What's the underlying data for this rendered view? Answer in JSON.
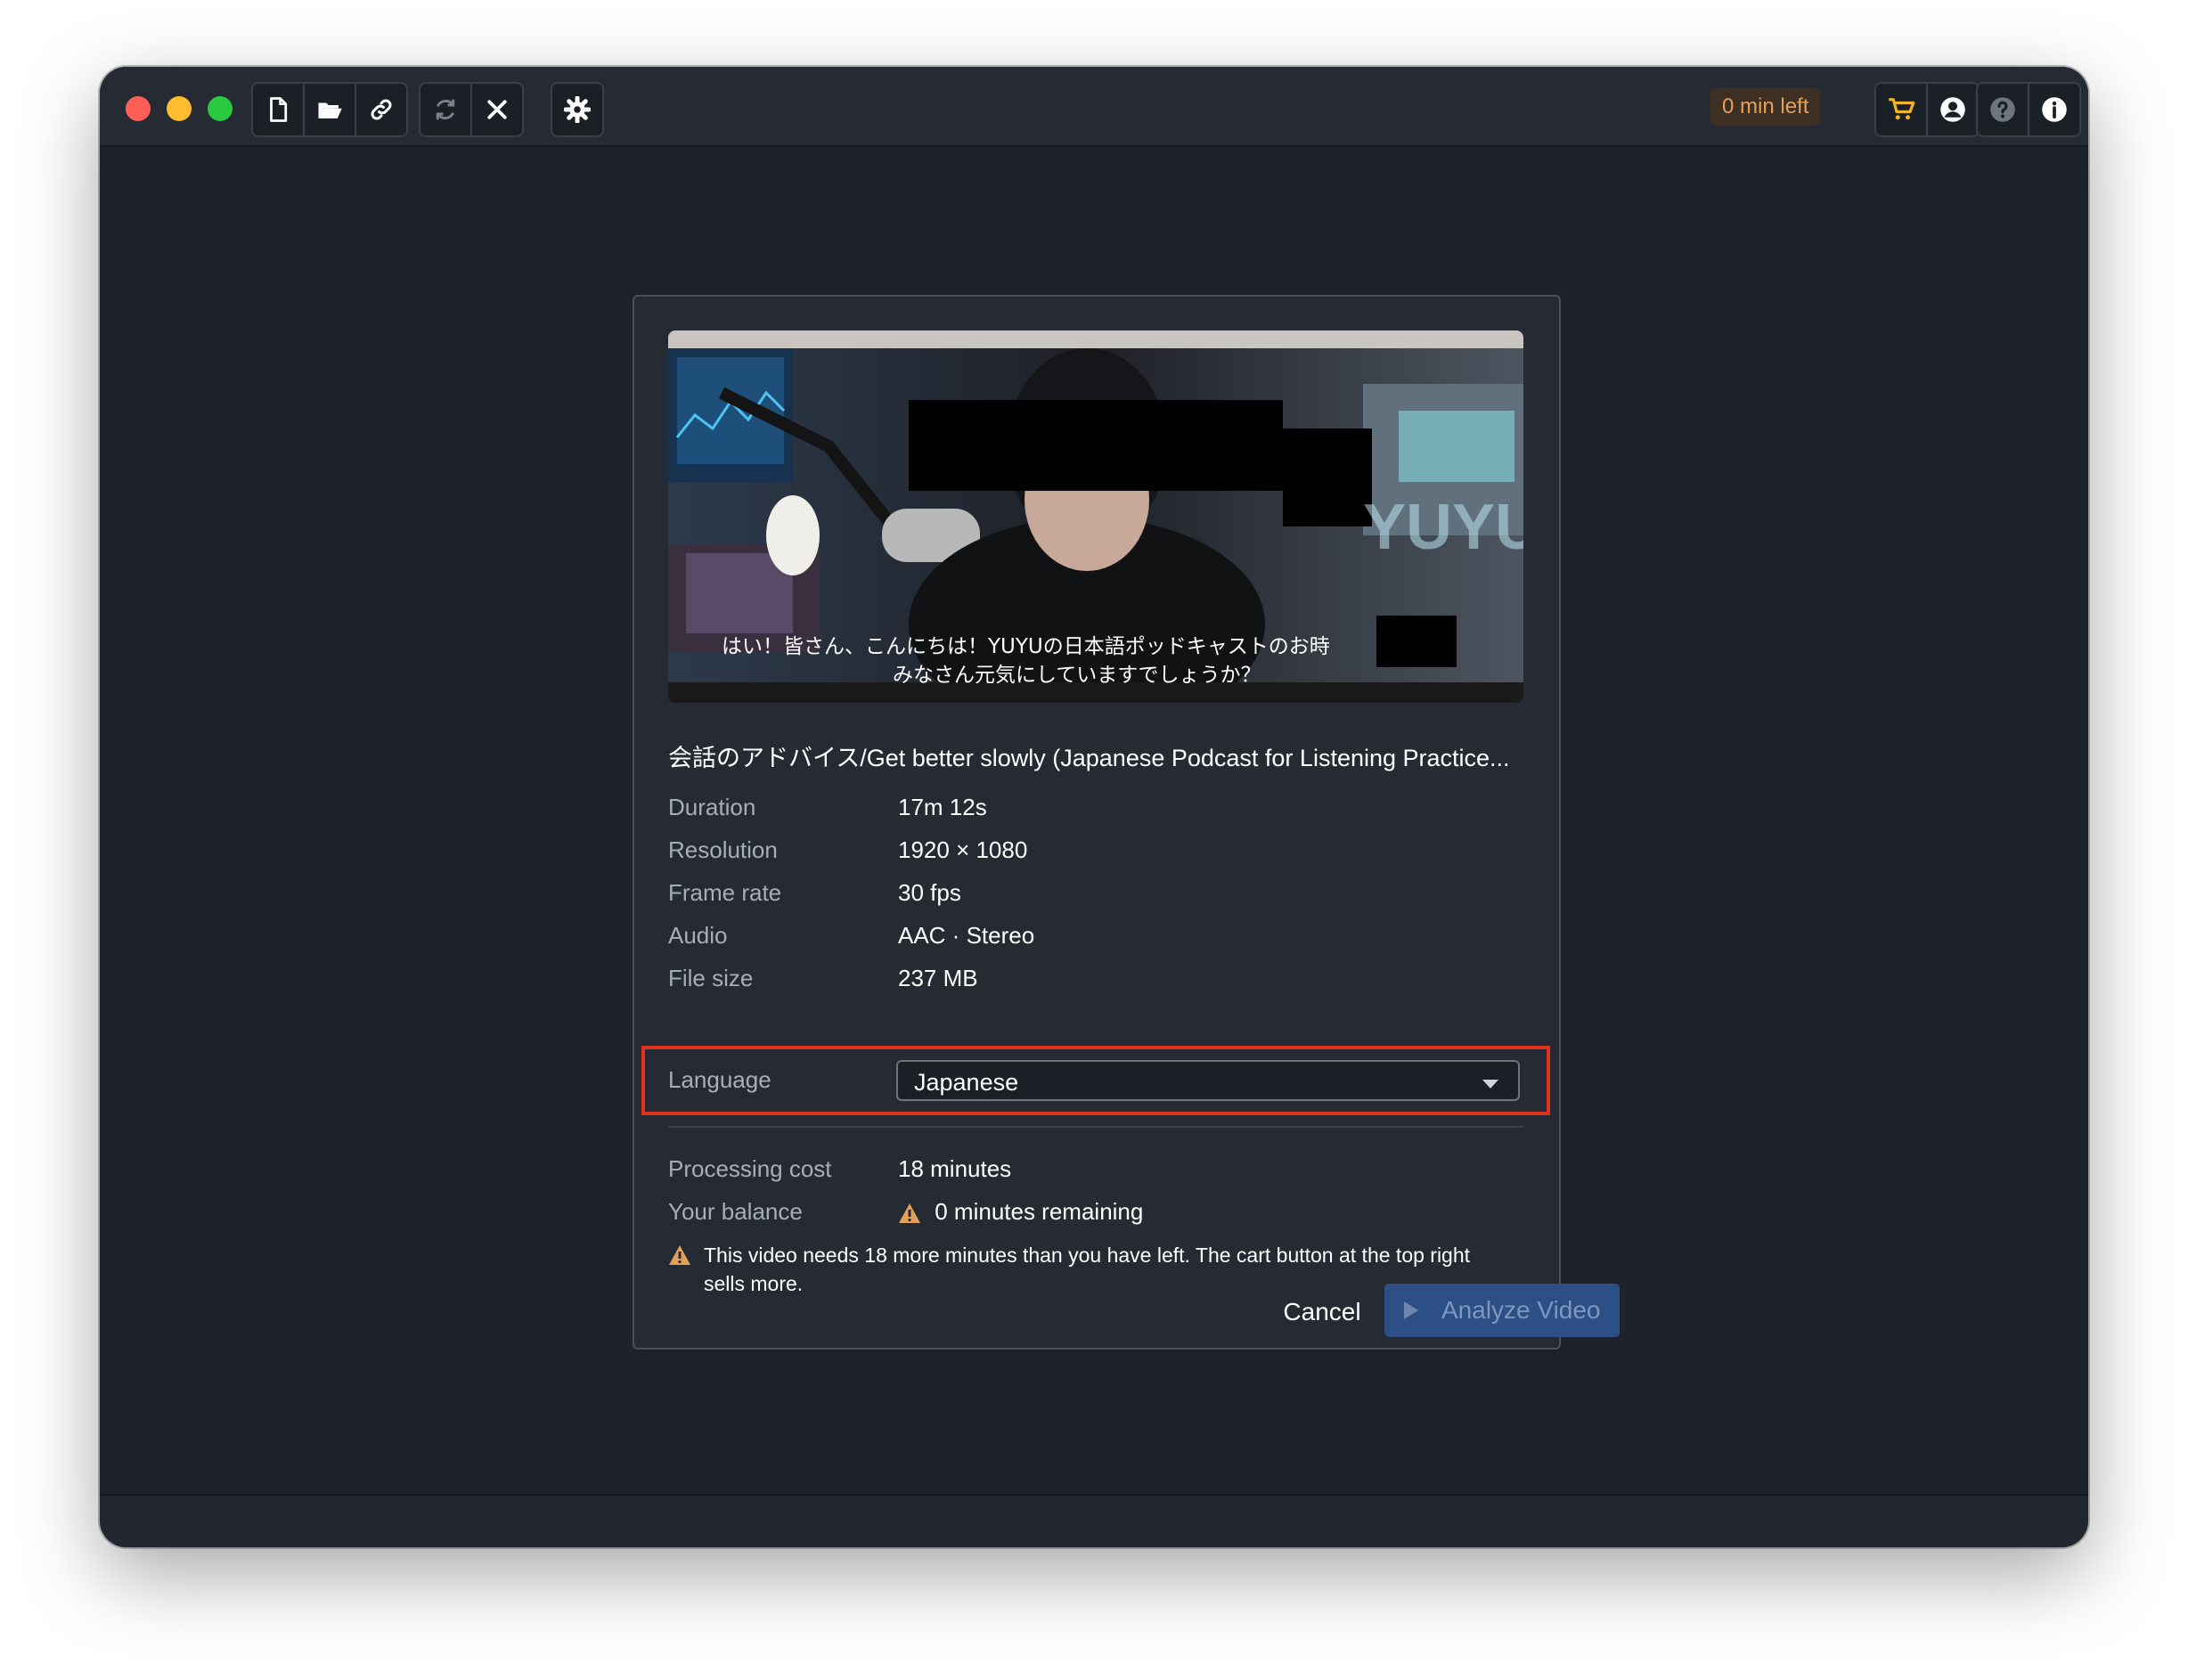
{
  "toolbar": {
    "time_left_badge": "0 min left",
    "icons": [
      "new-file-icon",
      "open-folder-icon",
      "link-icon",
      "refresh-icon",
      "close-icon",
      "gear-icon",
      "cart-icon",
      "account-icon",
      "help-icon",
      "info-icon"
    ]
  },
  "dialog": {
    "thumbnail_subtitles": [
      "はい！皆さん、こんにちは！YUYUの日本語ポッドキャストのお時",
      "みなさん元気にしていますでしょうか？"
    ],
    "thumbnail_overlay_text": "YUYU",
    "video_title": "会話のアドバイス/Get better slowly (Japanese Podcast for Listening Practice...",
    "details": [
      {
        "label": "Duration",
        "value": "17m 12s"
      },
      {
        "label": "Resolution",
        "value": "1920 × 1080"
      },
      {
        "label": "Frame rate",
        "value": "30 fps"
      },
      {
        "label": "Audio",
        "value": "AAC · Stereo"
      },
      {
        "label": "File size",
        "value": "237 MB"
      }
    ],
    "language": {
      "label": "Language",
      "selected": "Japanese"
    },
    "cost": {
      "label": "Processing cost",
      "value": "18 minutes"
    },
    "balance": {
      "label": "Your balance",
      "value": "0 minutes remaining"
    },
    "warning": "This video needs 18 more minutes than you have left. The cart button at the top right sells more.",
    "cancel_label": "Cancel",
    "analyze_label": "Analyze Video"
  },
  "colors": {
    "accent_warning": "#e3a05a",
    "highlight": "#e0301e",
    "primary_disabled": "#2c4f86"
  }
}
